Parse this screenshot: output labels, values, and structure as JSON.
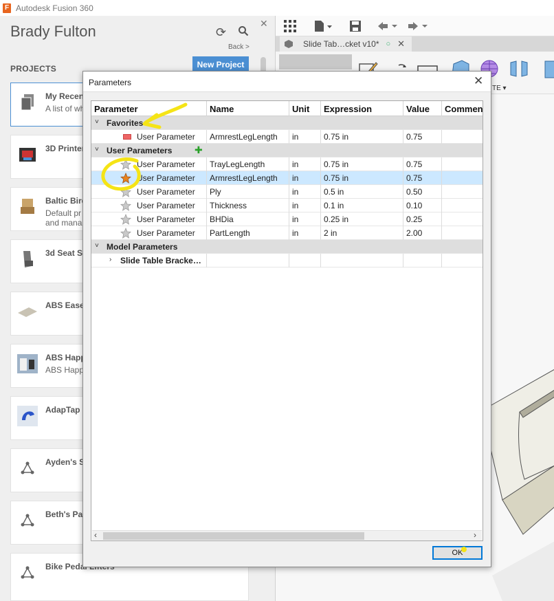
{
  "app": {
    "title": "Autodesk Fusion 360",
    "logo_letter": "F"
  },
  "data_panel": {
    "user_name": "Brady Fulton",
    "back_label": "Back >",
    "projects_label": "PROJECTS",
    "new_project_label": "New Project",
    "projects": [
      {
        "title": "My Recen",
        "subtitle": "A list of wh",
        "icon": "documents-icon"
      },
      {
        "title": "3D Printer",
        "subtitle": "",
        "icon": "printer-icon"
      },
      {
        "title": "Baltic Bird",
        "subtitle": "Default pr\nand mana",
        "icon": "chair-icon"
      },
      {
        "title": "3d Seat S",
        "subtitle": "",
        "icon": "seat-icon"
      },
      {
        "title": "ABS Ease",
        "subtitle": "",
        "icon": "board-icon"
      },
      {
        "title": "ABS Happ",
        "subtitle": "ABS Happ",
        "icon": "photo-icon"
      },
      {
        "title": "AdapTap",
        "subtitle": "",
        "icon": "tap-icon"
      },
      {
        "title": "Ayden's S",
        "subtitle": "",
        "icon": "fusion-placeholder-icon"
      },
      {
        "title": "Beth's Pa",
        "subtitle": "",
        "icon": "fusion-placeholder-icon"
      },
      {
        "title": "Bike Pedal Lifters",
        "subtitle": "",
        "icon": "fusion-placeholder-icon"
      }
    ]
  },
  "workspace": {
    "doc_tab_label": "Slide Tab…cket v10*",
    "ribbon_fragment": "TE ▾"
  },
  "dialog": {
    "title": "Parameters",
    "columns": [
      "Parameter",
      "Name",
      "Unit",
      "Expression",
      "Value",
      "Commen"
    ],
    "groups": {
      "favorites": "Favorites",
      "user": "User Parameters",
      "model": "Model Parameters"
    },
    "favorite_rows": [
      {
        "parameter": "User Parameter",
        "name": "ArmrestLegLength",
        "unit": "in",
        "expression": "0.75 in",
        "value": "0.75"
      }
    ],
    "user_rows": [
      {
        "parameter": "User Parameter",
        "name": "TrayLegLength",
        "unit": "in",
        "expression": "0.75 in",
        "value": "0.75",
        "favorite": false
      },
      {
        "parameter": "User Parameter",
        "name": "ArmrestLegLength",
        "unit": "in",
        "expression": "0.75 in",
        "value": "0.75",
        "favorite": true
      },
      {
        "parameter": "User Parameter",
        "name": "Ply",
        "unit": "in",
        "expression": "0.5 in",
        "value": "0.50",
        "favorite": false
      },
      {
        "parameter": "User Parameter",
        "name": "Thickness",
        "unit": "in",
        "expression": "0.1 in",
        "value": "0.10",
        "favorite": false
      },
      {
        "parameter": "User Parameter",
        "name": "BHDia",
        "unit": "in",
        "expression": "0.25 in",
        "value": "0.25",
        "favorite": false
      },
      {
        "parameter": "User Parameter",
        "name": "PartLength",
        "unit": "in",
        "expression": "2 in",
        "value": "2.00",
        "favorite": false
      }
    ],
    "model_child": "Slide Table Bracke…",
    "ok_label": "OK",
    "colors": {
      "highlight_row": "#cce8ff",
      "favorite_star": "#e8841f",
      "annotation": "#f5e416"
    }
  }
}
